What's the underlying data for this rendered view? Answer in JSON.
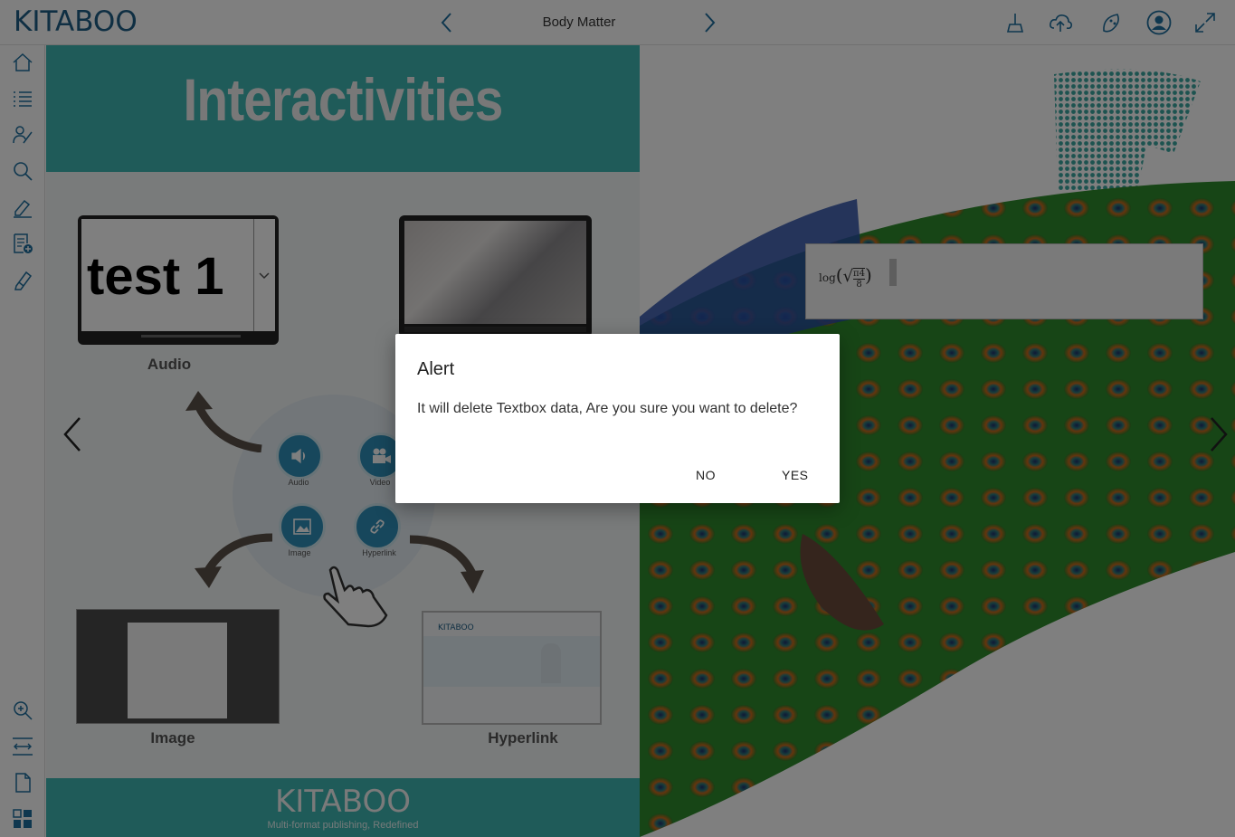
{
  "header": {
    "logo_text": "KITABOO",
    "section_title": "Body Matter",
    "prev_icon": "chevron-left-icon",
    "next_icon": "chevron-right-icon",
    "icons": [
      "clear-highlights-icon",
      "cloud-upload-icon",
      "theme-icon",
      "profile-icon",
      "fullscreen-icon"
    ]
  },
  "sidebar": {
    "top_items": [
      "home-icon",
      "toc-icon",
      "my-data-icon",
      "search-icon",
      "pen-tool-icon",
      "add-note-icon",
      "highlighter-icon"
    ],
    "bottom_items": [
      "zoom-in-icon",
      "fit-width-icon",
      "single-page-icon",
      "thumbnails-icon"
    ]
  },
  "left_page": {
    "title": "Interactivities",
    "audio_caption": "Audio",
    "audio_screen_text": "test 1",
    "image_caption": "Image",
    "hyperlink_caption": "Hyperlink",
    "hub_items": [
      "Audio",
      "Video",
      "Image",
      "Hyperlink"
    ],
    "footer_logo": "KITABOO",
    "footer_tagline": "Multi-format publishing, Redefined",
    "hyperlink_site_logo": "KITABOO"
  },
  "right_page": {
    "math": {
      "fn": "log",
      "numerator": "π4",
      "denominator": "8"
    }
  },
  "dialog": {
    "title": "Alert",
    "message": "It will delete Textbox data, Are you sure you want to delete?",
    "no_label": "NO",
    "yes_label": "YES"
  },
  "colors": {
    "teal": "#3fb6b2",
    "logo_blue": "#1f5e86",
    "overlay": "rgba(0,0,0,0.5)"
  }
}
